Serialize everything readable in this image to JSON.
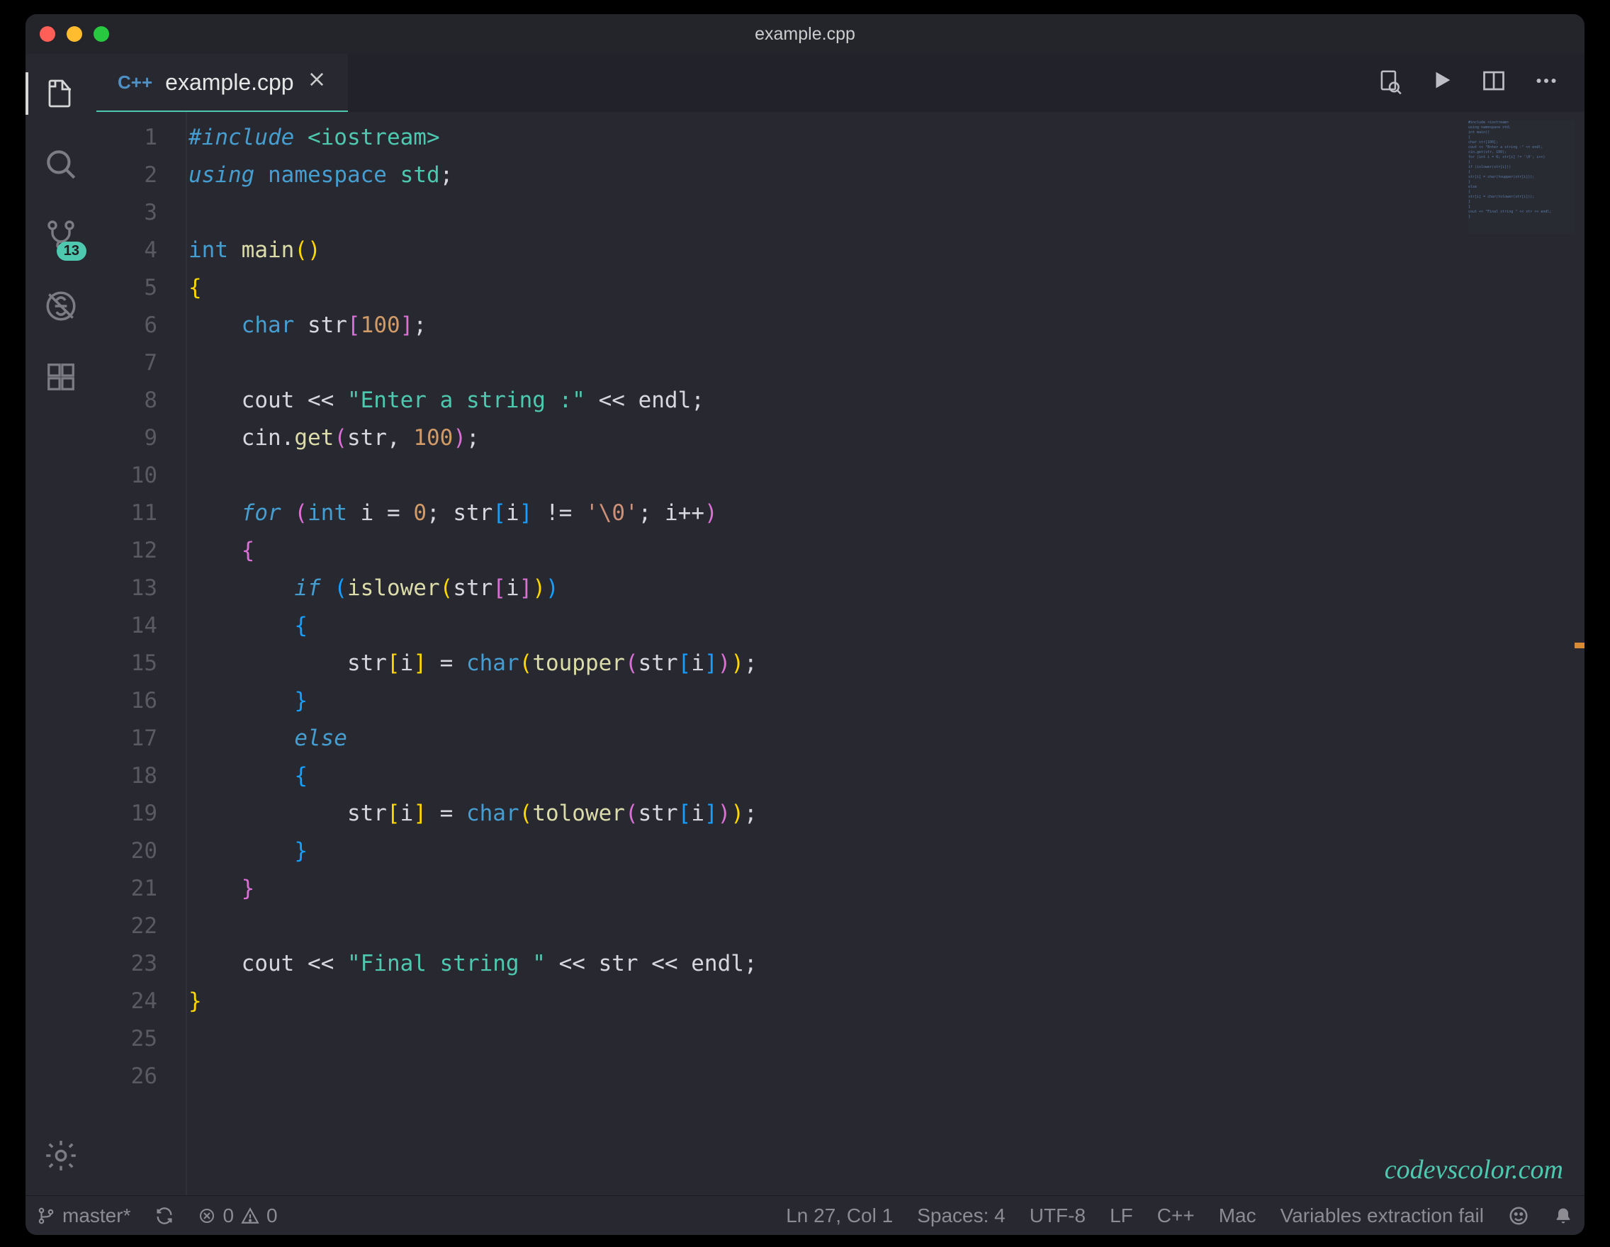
{
  "title": "example.cpp",
  "tab": {
    "lang": "C++",
    "name": "example.cpp"
  },
  "source_control_badge": "13",
  "watermark": "codevscolor.com",
  "statusbar": {
    "branch": "master*",
    "errors": "0",
    "warnings": "0",
    "cursor": "Ln 27, Col 1",
    "spaces": "Spaces: 4",
    "encoding": "UTF-8",
    "eol": "LF",
    "language": "C++",
    "os": "Mac",
    "message": "Variables extraction fail"
  },
  "total_lines": 26,
  "code_lines": [
    [
      [
        "kw",
        "#include"
      ],
      [
        "op",
        " "
      ],
      [
        "inc",
        "<iostream>"
      ]
    ],
    [
      [
        "kw",
        "using"
      ],
      [
        "op",
        " "
      ],
      [
        "kw2",
        "namespace"
      ],
      [
        "op",
        " "
      ],
      [
        "ns",
        "std"
      ],
      [
        "op",
        ";"
      ]
    ],
    [],
    [
      [
        "kw2",
        "int"
      ],
      [
        "op",
        " "
      ],
      [
        "fn",
        "main"
      ],
      [
        "br",
        "("
      ],
      [
        "br",
        ")"
      ]
    ],
    [
      [
        "br",
        "{"
      ]
    ],
    [
      [
        "op",
        "    "
      ],
      [
        "kw2",
        "char"
      ],
      [
        "op",
        " "
      ],
      [
        "var",
        "str"
      ],
      [
        "brP",
        "["
      ],
      [
        "num",
        "100"
      ],
      [
        "brP",
        "]"
      ],
      [
        "op",
        ";"
      ]
    ],
    [],
    [
      [
        "op",
        "    "
      ],
      [
        "var",
        "cout"
      ],
      [
        "op",
        " << "
      ],
      [
        "str",
        "\"Enter a string :\""
      ],
      [
        "op",
        " << "
      ],
      [
        "var",
        "endl"
      ],
      [
        "op",
        ";"
      ]
    ],
    [
      [
        "op",
        "    "
      ],
      [
        "var",
        "cin"
      ],
      [
        "op",
        "."
      ],
      [
        "fn",
        "get"
      ],
      [
        "brP",
        "("
      ],
      [
        "var",
        "str"
      ],
      [
        "op",
        ", "
      ],
      [
        "num",
        "100"
      ],
      [
        "brP",
        ")"
      ],
      [
        "op",
        ";"
      ]
    ],
    [],
    [
      [
        "op",
        "    "
      ],
      [
        "kw",
        "for"
      ],
      [
        "op",
        " "
      ],
      [
        "brP",
        "("
      ],
      [
        "kw2",
        "int"
      ],
      [
        "op",
        " "
      ],
      [
        "var",
        "i"
      ],
      [
        "op",
        " = "
      ],
      [
        "num",
        "0"
      ],
      [
        "op",
        "; "
      ],
      [
        "var",
        "str"
      ],
      [
        "brB",
        "["
      ],
      [
        "var",
        "i"
      ],
      [
        "brB",
        "]"
      ],
      [
        "op",
        " != "
      ],
      [
        "chr",
        "'\\0'"
      ],
      [
        "op",
        "; "
      ],
      [
        "var",
        "i"
      ],
      [
        "op",
        "++"
      ],
      [
        "brP",
        ")"
      ]
    ],
    [
      [
        "op",
        "    "
      ],
      [
        "brP",
        "{"
      ]
    ],
    [
      [
        "op",
        "        "
      ],
      [
        "kw",
        "if"
      ],
      [
        "op",
        " "
      ],
      [
        "brB",
        "("
      ],
      [
        "fn",
        "islower"
      ],
      [
        "br",
        "("
      ],
      [
        "var",
        "str"
      ],
      [
        "brP",
        "["
      ],
      [
        "var",
        "i"
      ],
      [
        "brP",
        "]"
      ],
      [
        "br",
        ")"
      ],
      [
        "brB",
        ")"
      ]
    ],
    [
      [
        "op",
        "        "
      ],
      [
        "brB",
        "{"
      ]
    ],
    [
      [
        "op",
        "            "
      ],
      [
        "var",
        "str"
      ],
      [
        "br",
        "["
      ],
      [
        "var",
        "i"
      ],
      [
        "br",
        "]"
      ],
      [
        "op",
        " = "
      ],
      [
        "kw2",
        "char"
      ],
      [
        "br",
        "("
      ],
      [
        "fn",
        "toupper"
      ],
      [
        "brP",
        "("
      ],
      [
        "var",
        "str"
      ],
      [
        "brB",
        "["
      ],
      [
        "var",
        "i"
      ],
      [
        "brB",
        "]"
      ],
      [
        "brP",
        ")"
      ],
      [
        "br",
        ")"
      ],
      [
        "op",
        ";"
      ]
    ],
    [
      [
        "op",
        "        "
      ],
      [
        "brB",
        "}"
      ]
    ],
    [
      [
        "op",
        "        "
      ],
      [
        "kw",
        "else"
      ]
    ],
    [
      [
        "op",
        "        "
      ],
      [
        "brB",
        "{"
      ]
    ],
    [
      [
        "op",
        "            "
      ],
      [
        "var",
        "str"
      ],
      [
        "br",
        "["
      ],
      [
        "var",
        "i"
      ],
      [
        "br",
        "]"
      ],
      [
        "op",
        " = "
      ],
      [
        "kw2",
        "char"
      ],
      [
        "br",
        "("
      ],
      [
        "fn",
        "tolower"
      ],
      [
        "brP",
        "("
      ],
      [
        "var",
        "str"
      ],
      [
        "brB",
        "["
      ],
      [
        "var",
        "i"
      ],
      [
        "brB",
        "]"
      ],
      [
        "brP",
        ")"
      ],
      [
        "br",
        ")"
      ],
      [
        "op",
        ";"
      ]
    ],
    [
      [
        "op",
        "        "
      ],
      [
        "brB",
        "}"
      ]
    ],
    [
      [
        "op",
        "    "
      ],
      [
        "brP",
        "}"
      ]
    ],
    [],
    [
      [
        "op",
        "    "
      ],
      [
        "var",
        "cout"
      ],
      [
        "op",
        " << "
      ],
      [
        "str",
        "\"Final string \""
      ],
      [
        "op",
        " << "
      ],
      [
        "var",
        "str"
      ],
      [
        "op",
        " << "
      ],
      [
        "var",
        "endl"
      ],
      [
        "op",
        ";"
      ]
    ],
    [
      [
        "br",
        "}"
      ]
    ],
    [],
    []
  ]
}
